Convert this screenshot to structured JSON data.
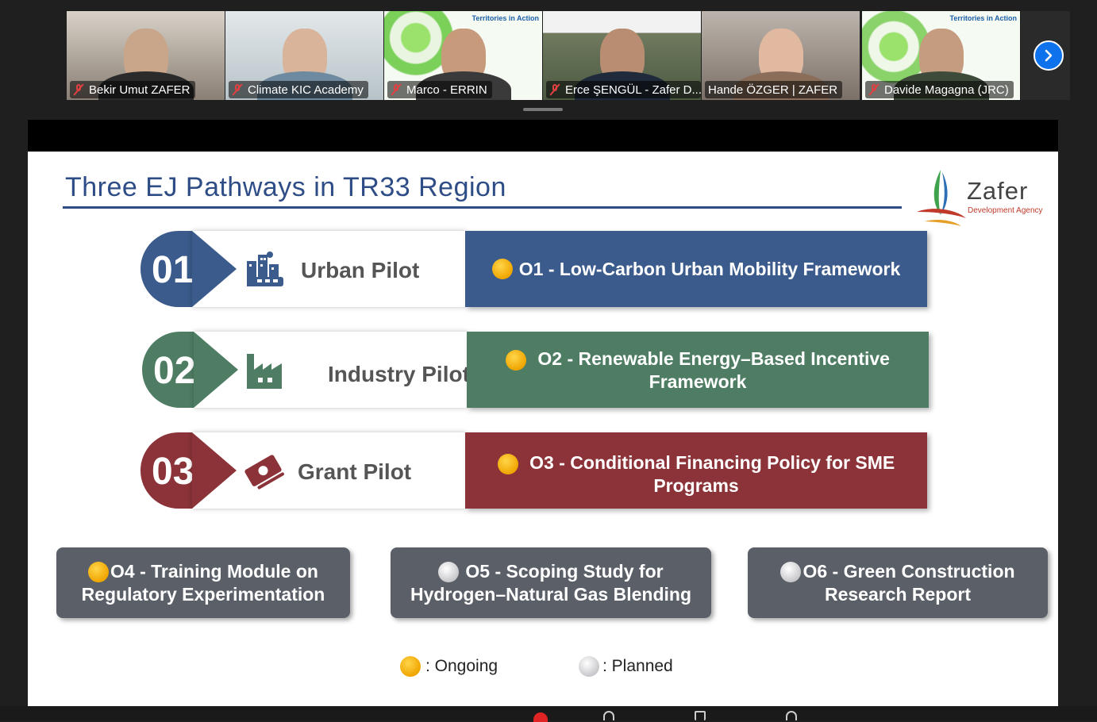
{
  "participants": [
    {
      "name": "Bekir Umut ZAFER",
      "muted": true,
      "active": false,
      "bg": "#8a7f74"
    },
    {
      "name": "Climate KIC Academy",
      "muted": true,
      "active": false,
      "bg": "#b7c3c9"
    },
    {
      "name": "Marco - ERRIN",
      "muted": true,
      "active": false,
      "bg": "#7bd05a",
      "tag": "Territories in Action"
    },
    {
      "name": "Erce ŞENGÜL - Zafer D...",
      "muted": true,
      "active": false,
      "bg": "#6f7a5e"
    },
    {
      "name": "Hande ÖZGER | ZAFER",
      "muted": false,
      "active": true,
      "bg": "#9a8f86"
    },
    {
      "name": "Davide Magagna (JRC)",
      "muted": true,
      "active": false,
      "bg": "#8ad36a",
      "tag": "Territories in Action"
    }
  ],
  "slide": {
    "title": "Three EJ Pathways in TR33 Region",
    "logo": {
      "name": "Zafer",
      "subtitle": "Development Agency"
    },
    "pilots": [
      {
        "number": "01",
        "label": "Urban Pilot",
        "icon": "city-icon",
        "color": "#3b5b8c",
        "objective": "O1 - Low-Carbon Urban Mobility Framework",
        "status": "ongoing"
      },
      {
        "number": "02",
        "label": "Industry Pilot",
        "icon": "factory-icon",
        "color": "#4e7d64",
        "objective": "O2 - Renewable Energy–Based Incentive Framework",
        "status": "ongoing"
      },
      {
        "number": "03",
        "label": "Grant Pilot",
        "icon": "money-icon",
        "color": "#8b3338",
        "objective": "O3 - Conditional Financing Policy for SME Programs",
        "status": "ongoing"
      }
    ],
    "extra_objectives": [
      {
        "text": "O4 - Training Module on Regulatory Experimentation",
        "status": "ongoing"
      },
      {
        "text": "O5 - Scoping Study for Hydrogen–Natural Gas Blending",
        "status": "planned"
      },
      {
        "text": "O6 - Green Construction Research Report",
        "status": "planned"
      }
    ],
    "legend": {
      "ongoing": ": Ongoing",
      "planned": ": Planned"
    }
  },
  "colors": {
    "accent": "#2e4d86",
    "ongoing": "#f0a500",
    "planned": "#c8c8cc",
    "active_speaker": "#22c55e"
  }
}
